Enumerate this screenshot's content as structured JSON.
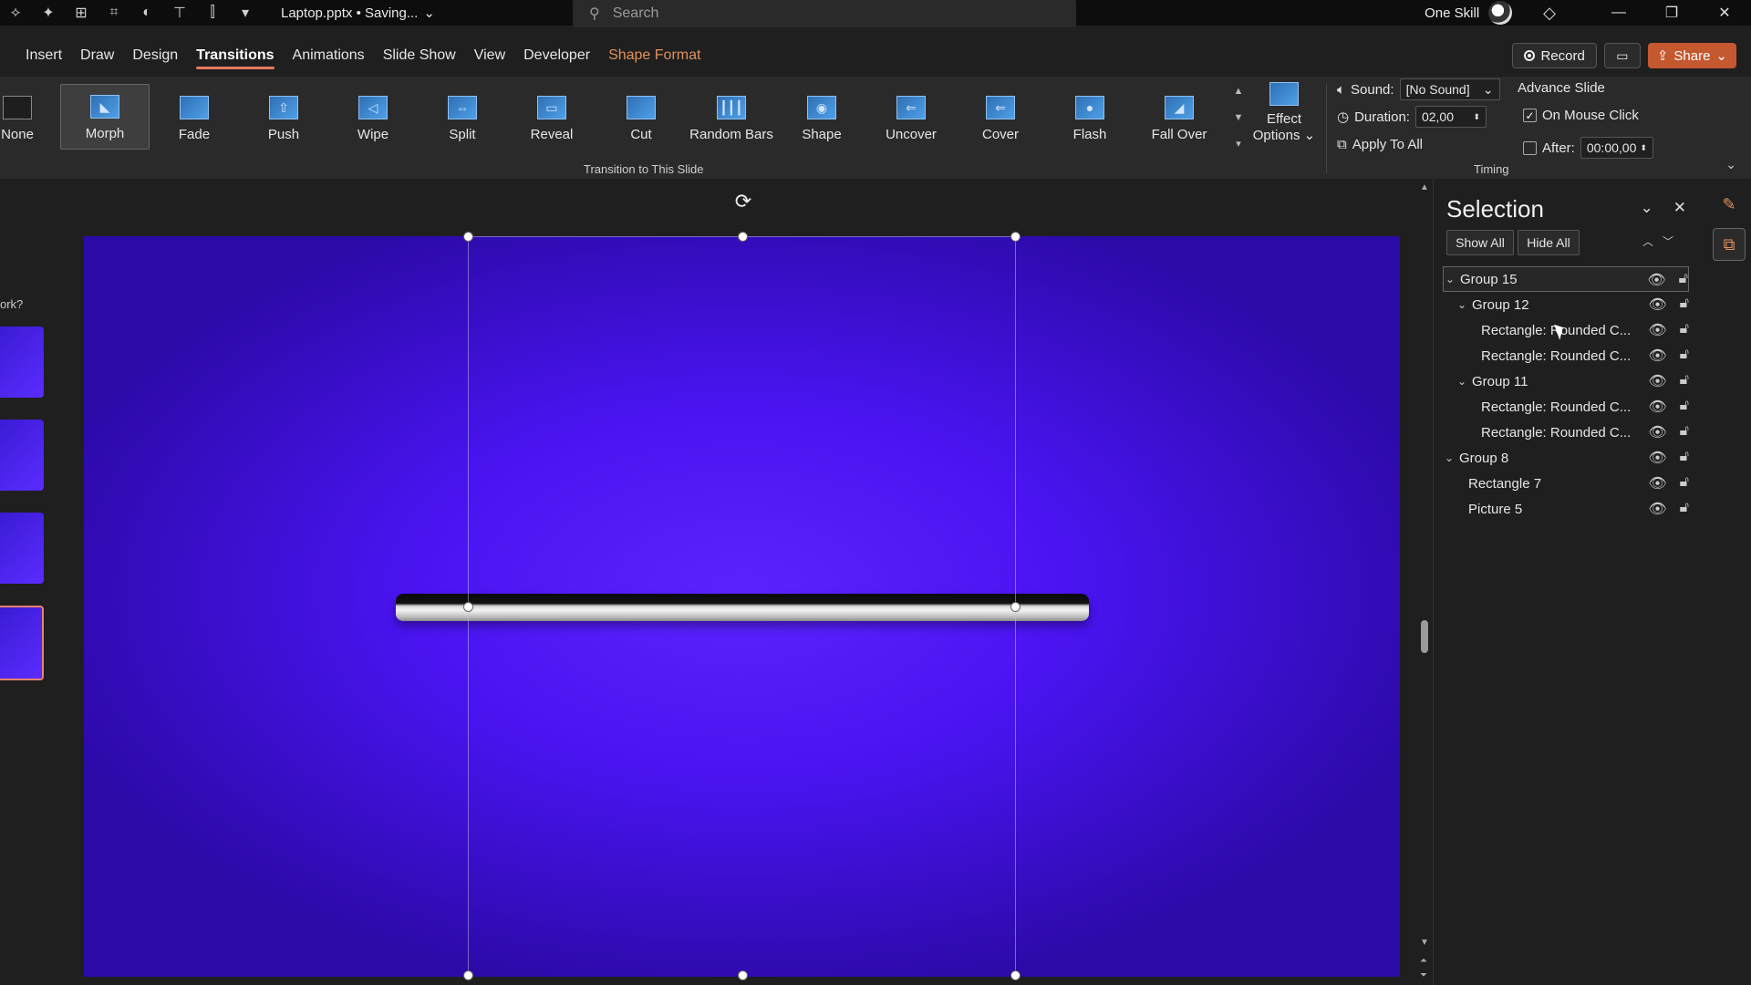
{
  "title_bar": {
    "doc_title": "Laptop.pptx • Saving...",
    "search_placeholder": "Search",
    "user_name": "One Skill"
  },
  "tabs": [
    "Insert",
    "Draw",
    "Design",
    "Transitions",
    "Animations",
    "Slide Show",
    "View",
    "Developer",
    "Shape Format"
  ],
  "active_tab": "Transitions",
  "actions": {
    "record": "Record",
    "share": "Share"
  },
  "transitions": {
    "items": [
      "None",
      "Morph",
      "Fade",
      "Push",
      "Wipe",
      "Split",
      "Reveal",
      "Cut",
      "Random Bars",
      "Shape",
      "Uncover",
      "Cover",
      "Flash",
      "Fall Over"
    ],
    "selected": "Morph",
    "effect_options_line1": "Effect",
    "effect_options_line2": "Options",
    "group_label": "Transition to This Slide"
  },
  "timing": {
    "sound_label": "Sound:",
    "sound_value": "[No Sound]",
    "duration_label": "Duration:",
    "duration_value": "02,00",
    "apply_all": "Apply To All",
    "advance_slide": "Advance Slide",
    "on_mouse_click": "On Mouse Click",
    "after_label": "After:",
    "after_value": "00:00,00",
    "group_label": "Timing"
  },
  "thumbnails": {
    "partial_text": "ork?"
  },
  "selection_pane": {
    "title": "Selection",
    "show_all": "Show All",
    "hide_all": "Hide All",
    "items": [
      {
        "label": "Group 15",
        "level": 0,
        "expanded": true
      },
      {
        "label": "Group 12",
        "level": 1,
        "expanded": true
      },
      {
        "label": "Rectangle: Rounded C...",
        "level": 2
      },
      {
        "label": "Rectangle: Rounded C...",
        "level": 2
      },
      {
        "label": "Group 11",
        "level": 1,
        "expanded": true
      },
      {
        "label": "Rectangle: Rounded C...",
        "level": 2
      },
      {
        "label": "Rectangle: Rounded C...",
        "level": 2
      },
      {
        "label": "Group 8",
        "level": 0,
        "expanded": true
      },
      {
        "label": "Rectangle 7",
        "level": 1
      },
      {
        "label": "Picture 5",
        "level": 1
      }
    ]
  },
  "colors": {
    "accent": "#e87a5c",
    "share": "#c4582f",
    "slide_bg": "#4a14f2"
  }
}
